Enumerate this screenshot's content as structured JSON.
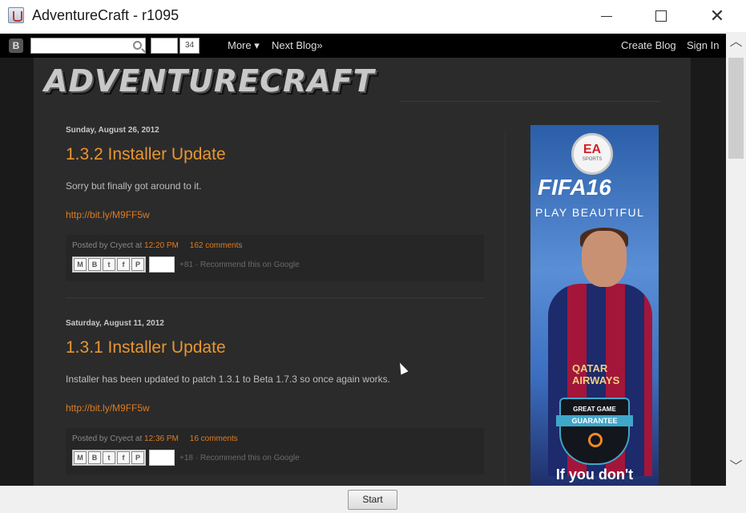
{
  "window": {
    "title": "AdventureCraft - r1095",
    "minimize": "",
    "maximize": "",
    "close": "✕"
  },
  "navbar": {
    "logo": "B",
    "search_value": "",
    "plusone_count": "34",
    "more": "More ▾",
    "next_blog": "Next Blog»",
    "create_blog": "Create Blog",
    "sign_in": "Sign In"
  },
  "blog": {
    "header_title": "ADVENTURECRAFT"
  },
  "posts": [
    {
      "date": "Sunday, August 26, 2012",
      "title": "1.3.2 Installer Update",
      "body": "Sorry but finally got around to it.",
      "link": "http://bit.ly/M9FF5w",
      "posted_by_prefix": "Posted by Cryect at",
      "time": "12:20 PM",
      "comments": "162 comments",
      "plus_count": "+81",
      "recommend": "Recommend this on Google"
    },
    {
      "date": "Saturday, August 11, 2012",
      "title": "1.3.1 Installer Update",
      "body": "Installer has been updated to patch 1.3.1 to Beta 1.7.3 so once again works.",
      "link": "http://bit.ly/M9FF5w",
      "posted_by_prefix": "Posted by Cryect at",
      "time": "12:36 PM",
      "comments": "16 comments",
      "plus_count": "+18",
      "recommend": "Recommend this on Google"
    }
  ],
  "share_icons": [
    "email-icon",
    "blog-this-icon",
    "twitter-icon",
    "facebook-icon",
    "pinterest-icon"
  ],
  "share_glyphs": [
    "M",
    "B",
    "t",
    "f",
    "P"
  ],
  "ad": {
    "logo_text": "EA",
    "logo_sub": "SPORTS",
    "headline": "FIFA16",
    "tagline": "PLAY BEAUTIFUL",
    "shirt_text": "QATAR AIRWAYS",
    "badge_top": "GREAT GAME",
    "badge_bar": "GUARANTEE",
    "bottom": "If you don't"
  },
  "scrollbar": {
    "up": "︿",
    "down": "﹀"
  },
  "footer": {
    "start": "Start"
  },
  "colors": {
    "accent": "#e99630",
    "link": "#e07b20",
    "background": "#2b2b2b"
  }
}
